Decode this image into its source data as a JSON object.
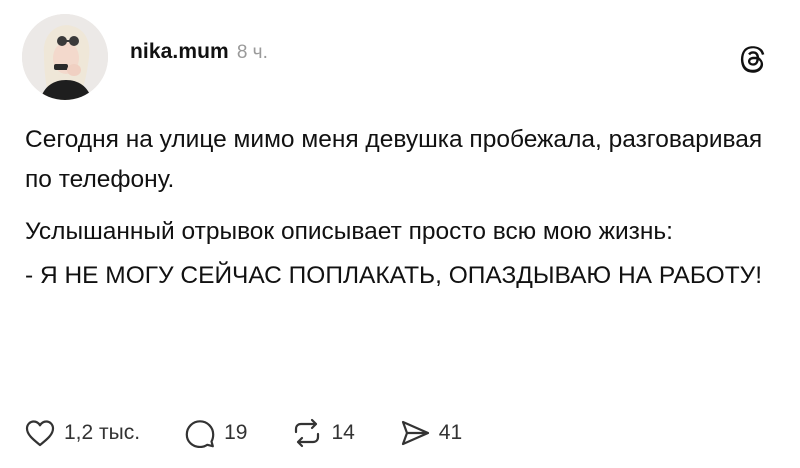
{
  "post": {
    "author": {
      "username": "nika.mum",
      "time": "8 ч.",
      "avatar_icon": "avatar-photo"
    },
    "logo_icon": "threads-logo-icon",
    "text": {
      "paragraph_1": "Сегодня на улице мимо меня девушка пробежала, разговаривая по телефону.",
      "paragraph_2": "Услышанный отрывок описывает просто всю мою жизнь:",
      "paragraph_3": "- Я НЕ МОГУ СЕЙЧАС ПОПЛАКАТЬ, ОПАЗДЫВАЮ НА РАБОТУ!"
    },
    "actions": {
      "likes": "1,2 тыс.",
      "replies": "19",
      "reposts": "14",
      "shares": "41"
    }
  }
}
